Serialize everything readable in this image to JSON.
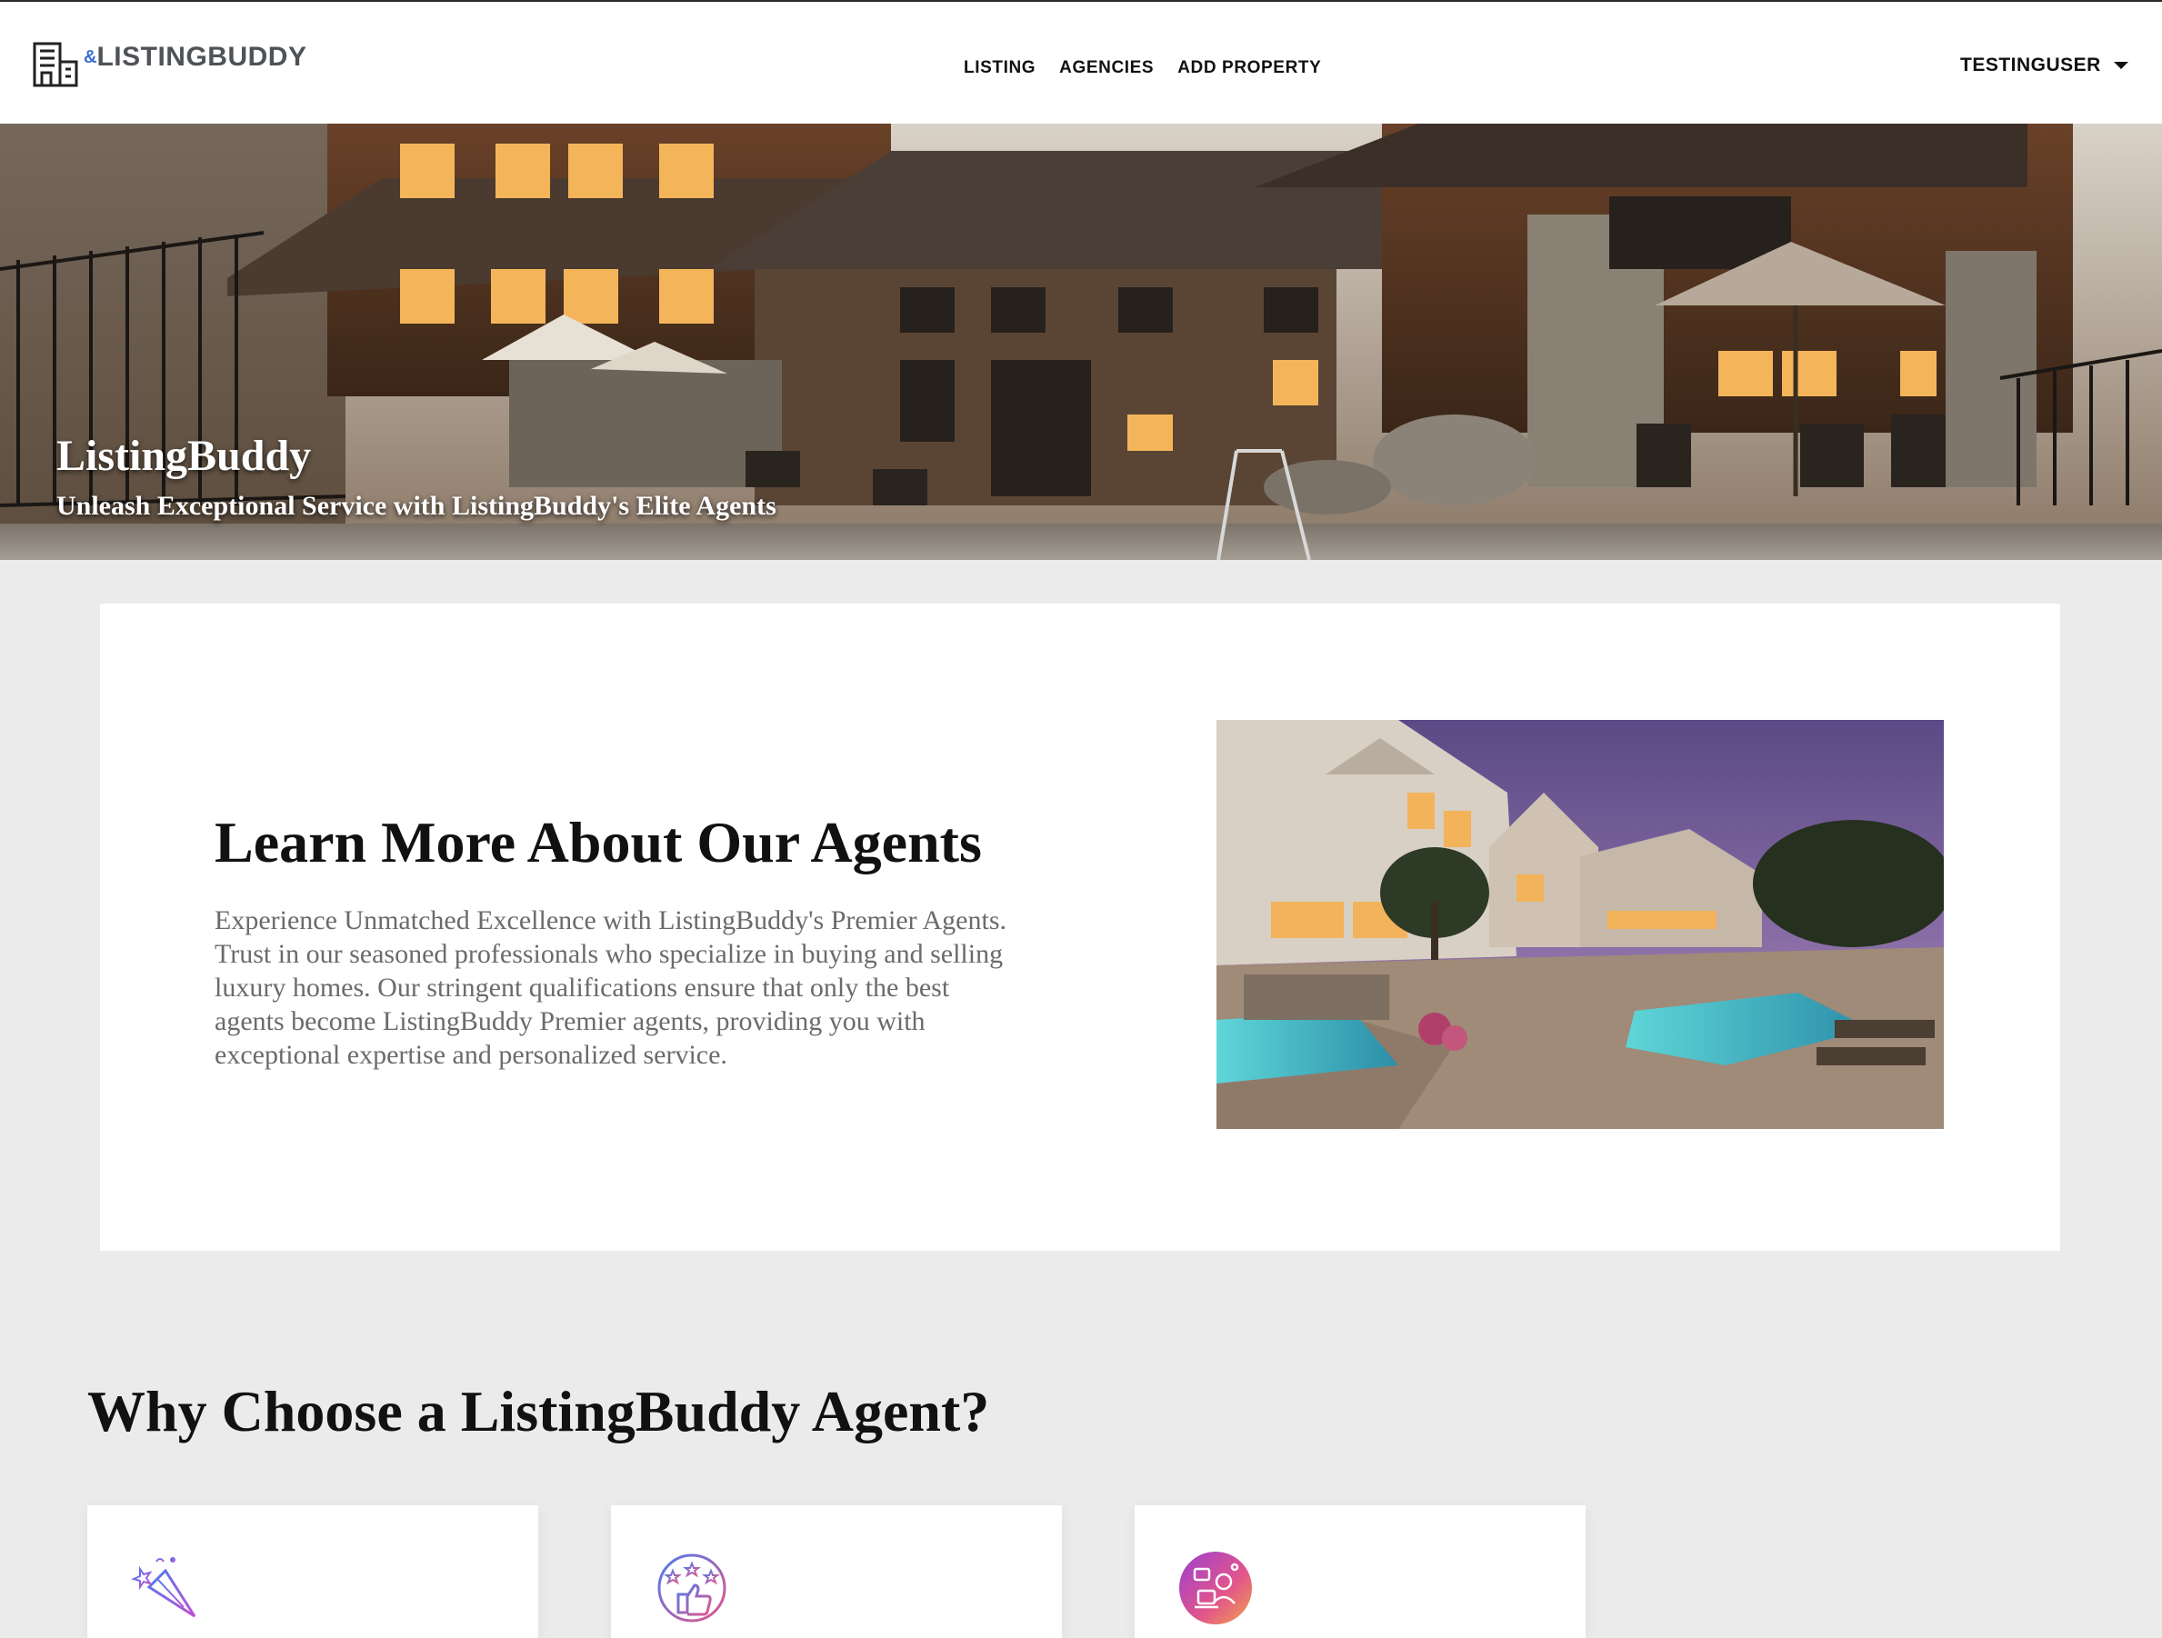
{
  "header": {
    "brand_amp": "&",
    "brand_name": "LISTINGBUDDY",
    "nav": [
      {
        "label": "LISTING"
      },
      {
        "label": "AGENCIES"
      },
      {
        "label": "ADD PROPERTY"
      }
    ],
    "user": "TESTINGUSER"
  },
  "hero": {
    "title": "ListingBuddy",
    "subtitle": "Unleash Exceptional Service with ListingBuddy's Elite Agents"
  },
  "about": {
    "heading": "Learn More About Our Agents",
    "text": "Experience Unmatched Excellence with ListingBuddy's Premier Agents. Trust in our seasoned professionals who specialize in buying and selling luxury homes. Our stringent qualifications ensure that only the best agents become ListingBuddy Premier agents, providing you with exceptional expertise and personalized service."
  },
  "why": {
    "heading": "Why Choose a ListingBuddy Agent?",
    "cards": [
      {
        "icon": "party-popper-icon"
      },
      {
        "icon": "thumbs-up-stars-icon"
      },
      {
        "icon": "agent-support-icon"
      }
    ]
  },
  "colors": {
    "brand_accent": "#3b6fd1",
    "page_background": "#ebebeb",
    "card_background": "#ffffff"
  }
}
